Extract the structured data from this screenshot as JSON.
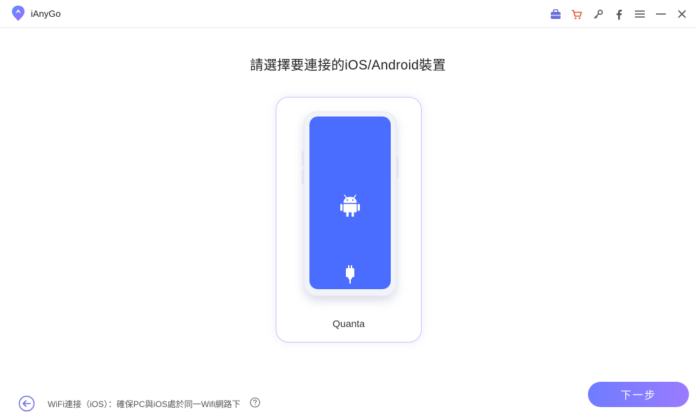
{
  "app": {
    "name": "iAnyGo"
  },
  "titlebar": {
    "icons": [
      "toolbox-icon",
      "cart-icon",
      "key-icon",
      "facebook-icon",
      "menu-icon",
      "minimize-icon",
      "close-icon"
    ]
  },
  "main": {
    "title": "請選擇要連接的iOS/Android裝置",
    "device": {
      "name": "Quanta",
      "platform_icon": "android-icon",
      "connection_icon": "usb-cable-icon",
      "screen_color": "#4a6cff"
    }
  },
  "footer": {
    "back_icon": "arrow-left-circle-icon",
    "wifi_hint": "WiFi連接（iOS）：確保PC與iOS處於同一Wifi網路下",
    "help_icon": "question-circle-icon",
    "next_label": "下一步"
  },
  "colors": {
    "accent_start": "#6f7cff",
    "accent_end": "#9a7bff",
    "cart": "#e85a2f"
  }
}
